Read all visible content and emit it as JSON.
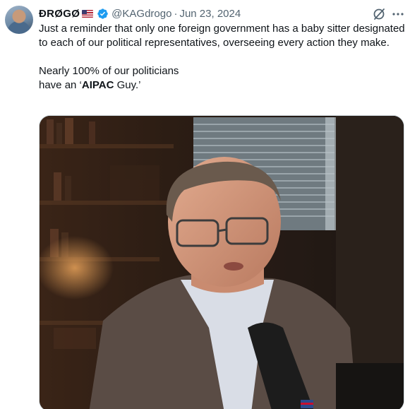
{
  "author": {
    "display_name": "ĐRØGØ",
    "handle": "@KAGdrogo",
    "separator": "·",
    "date": "Jun 23, 2024"
  },
  "icons": {
    "verified": "verified-badge-icon",
    "flag": "us-flag-icon",
    "grok": "grok-icon",
    "more": "more-icon"
  },
  "tweet": {
    "line1": "Just a reminder that only one foreign government has a baby sitter designated to each of our political representatives, overseeing every action they make.",
    "line2": "Nearly 100% of our politicians",
    "line3_pre": "have an ‘",
    "line3_bold": "AIPAC",
    "line3_post": " Guy.’"
  },
  "colors": {
    "verified_blue": "#1d9bf0",
    "secondary_text": "#536471"
  }
}
